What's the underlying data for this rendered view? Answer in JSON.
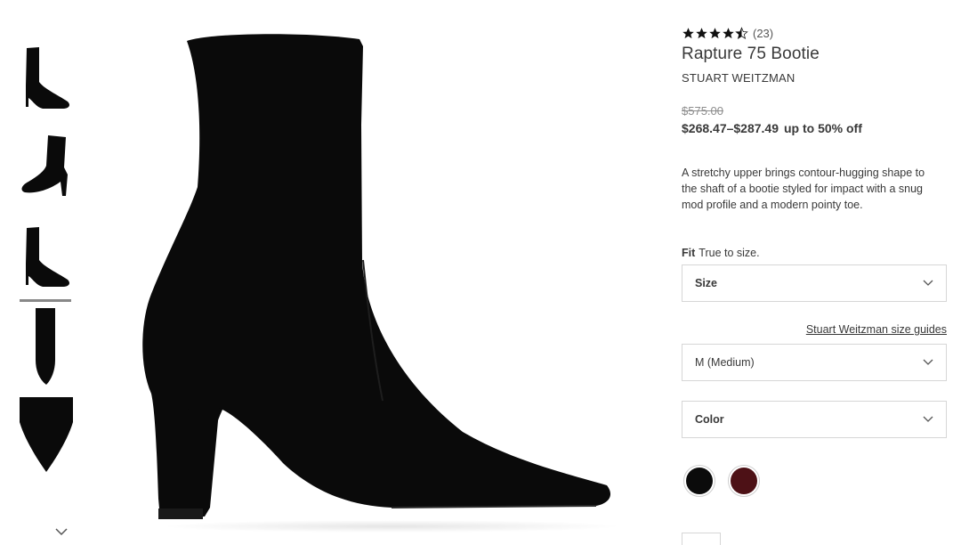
{
  "product": {
    "rating_value": 4.5,
    "rating_count": "(23)",
    "title": "Rapture 75 Bootie",
    "brand": "STUART WEITZMAN",
    "original_price": "$575.00",
    "sale_price": "$268.47–$287.49",
    "discount": "up to 50% off",
    "description": "A stretchy upper brings contour-hugging shape to the shaft of a bootie styled for impact with a snug mod profile and a modern pointy toe."
  },
  "fit": {
    "label": "Fit",
    "value": "True to size."
  },
  "selectors": {
    "size_label": "Size",
    "size_guide_link": "Stuart Weitzman size guides",
    "width_value": "M (Medium)",
    "color_label": "Color"
  },
  "swatches": [
    {
      "name": "black",
      "color": "#0b0b0b"
    },
    {
      "name": "burgundy",
      "color": "#4d1116"
    }
  ],
  "thumbnails": [
    {
      "view": "side-view"
    },
    {
      "view": "angle-view"
    },
    {
      "view": "side-view-alt"
    },
    {
      "view": "front-view"
    },
    {
      "view": "toe-detail"
    }
  ],
  "colors": {
    "text": "#393939",
    "muted": "#8d8d8d",
    "border": "#d6d6d6",
    "boot": "#0a0a0a"
  }
}
